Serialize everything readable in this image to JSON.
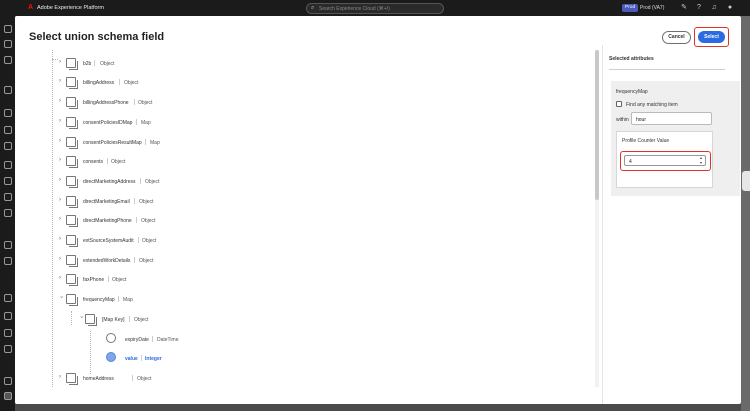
{
  "app": {
    "name": "Adobe Experience Platform",
    "search_placeholder": "Search Experience Cloud (⌘+/)",
    "env_badge": "Prod",
    "org_name": "Prod (VA7)"
  },
  "dialog": {
    "title": "Select union schema field",
    "cancel_label": "Cancel",
    "select_label": "Select"
  },
  "tree": {
    "rows": [
      {
        "name": "b2b",
        "type": "Object"
      },
      {
        "name": "billingAddress",
        "type": "Object"
      },
      {
        "name": "billingAddressPhone",
        "type": "Object"
      },
      {
        "name": "consentPoliciesIDMap",
        "type": "Map"
      },
      {
        "name": "consentPoliciesResultMap",
        "type": "Map"
      },
      {
        "name": "consents",
        "type": "Object"
      },
      {
        "name": "directMarketingAddress",
        "type": "Object"
      },
      {
        "name": "directMarketingEmail",
        "type": "Object"
      },
      {
        "name": "directMarketingPhone",
        "type": "Object"
      },
      {
        "name": "extSourceSystemAudit",
        "type": "Object"
      },
      {
        "name": "extendedWorkDetails",
        "type": "Object"
      },
      {
        "name": "faxPhone",
        "type": "Object"
      },
      {
        "name": "frequencyMap",
        "type": "Map"
      },
      {
        "name": "[Map Key]",
        "type": "Object"
      },
      {
        "name": "expiryDate",
        "type": "DateTime"
      },
      {
        "name": "value",
        "type": "Integer"
      },
      {
        "name": "homeAddress",
        "type": "Object"
      }
    ]
  },
  "selected_panel": {
    "title": "Selected attributes",
    "field_name": "frequencyMap",
    "find_any_label": "Find any matching item",
    "within_label": "within",
    "within_value": "hour",
    "counter_label": "Profile Counter Value",
    "counter_value": "4"
  }
}
